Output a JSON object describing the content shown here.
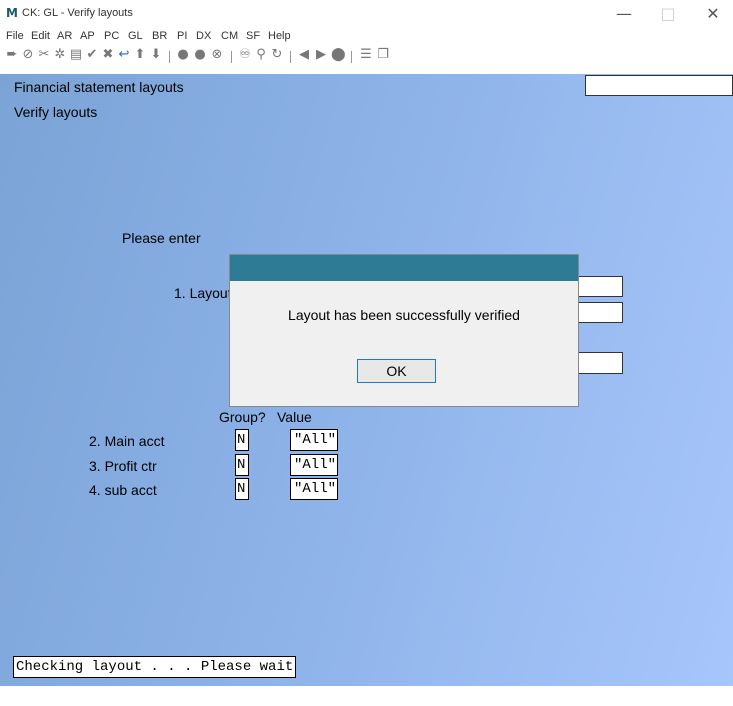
{
  "window": {
    "title": "CK: GL - Verify layouts",
    "logo": "M",
    "controls": [
      "—",
      "□",
      "✕"
    ]
  },
  "menu": [
    "File",
    "Edit",
    "AR",
    "AP",
    "PC",
    "GL",
    "BR",
    "PI",
    "DX",
    "CM",
    "SF",
    "Help"
  ],
  "toolbar_icons": [
    "next-icon",
    "cancel-icon",
    "tools-icon",
    "settings-icon",
    "print-icon",
    "check-icon",
    "delete-icon",
    "undo-icon",
    "up-icon",
    "down-icon",
    "circle-a-icon",
    "circle-b-icon",
    "circle-c-icon",
    "binoculars-icon",
    "search-icon",
    "refresh-icon",
    "prev-icon",
    "play-icon",
    "record-icon",
    "list-icon",
    "copy-icon"
  ],
  "screen": {
    "heading": "Financial statement layouts",
    "subheading": "Verify layouts",
    "prompt": "Please enter",
    "field1_label": "1. Layout",
    "col_group": "Group?",
    "col_value": "Value",
    "rows": [
      {
        "label": "2. Main acct",
        "group": "N",
        "value": "\"All\""
      },
      {
        "label": "3. Profit ctr",
        "group": "N",
        "value": "\"All\""
      },
      {
        "label": "4. sub acct",
        "group": "N",
        "value": "\"All\""
      }
    ]
  },
  "dialog": {
    "message": "Layout has been successfully verified",
    "ok_label": "OK"
  },
  "status": "Checking layout . . . Please wait",
  "colors": {
    "dialog_header": "#2e7b96",
    "background_start": "#7ca3d6",
    "background_end": "#a7c6fb",
    "ok_border": "#1c79c8"
  }
}
